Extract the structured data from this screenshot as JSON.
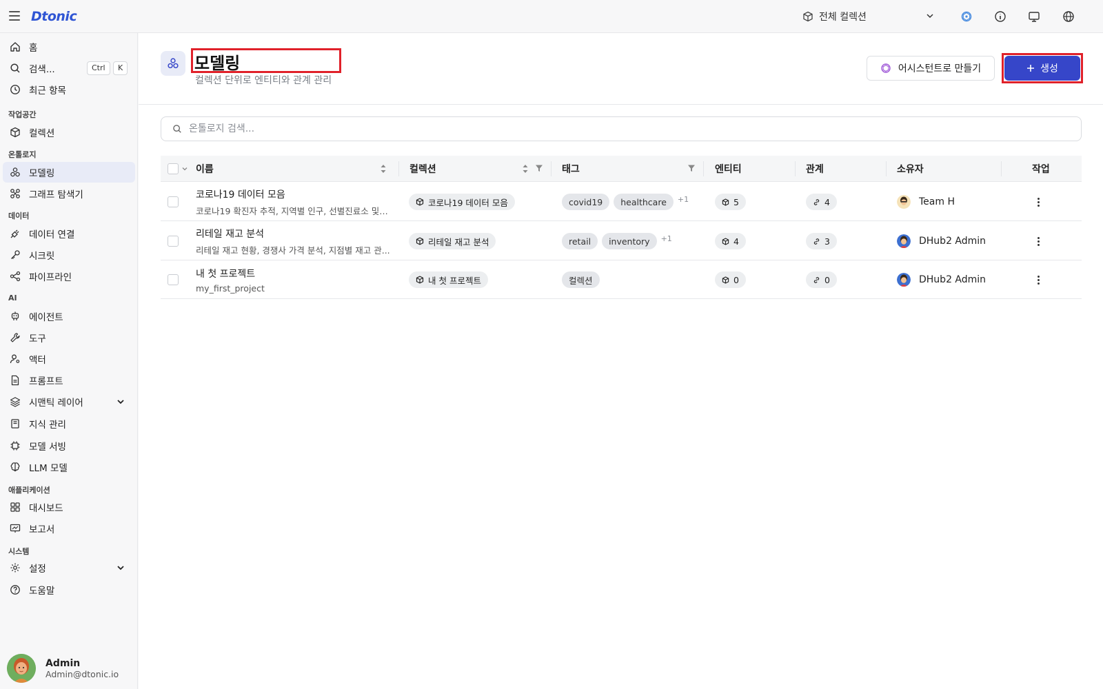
{
  "app": {
    "logo": "Dtonic"
  },
  "topbar": {
    "collection_selector": "전체 컬렉션"
  },
  "sidebar": {
    "home": "홈",
    "search": "검색...",
    "search_kbd_ctrl": "Ctrl",
    "search_kbd_k": "K",
    "recent": "최근 항목",
    "sections": {
      "workspace": "작업공간",
      "ontology": "온톨로지",
      "data": "데이터",
      "ai": "AI",
      "applications": "애플리케이션",
      "system": "시스템"
    },
    "items": {
      "collections": "컬렉션",
      "modeling": "모델링",
      "graph_explorer": "그래프 탐색기",
      "data_connection": "데이터 연결",
      "secrets": "시크릿",
      "pipelines": "파이프라인",
      "agents": "에이전트",
      "tools": "도구",
      "actors": "액터",
      "prompts": "프롬프트",
      "semantic_layer": "시맨틱 레이어",
      "knowledge": "지식 관리",
      "model_serving": "모델 서빙",
      "llm_models": "LLM 모델",
      "dashboards": "대시보드",
      "reports": "보고서",
      "settings": "설정",
      "help": "도움말"
    },
    "profile": {
      "name": "Admin",
      "email": "Admin@dtonic.io"
    }
  },
  "page": {
    "title": "모델링",
    "subtitle": "컬렉션 단위로 엔티티와 관계 관리",
    "assistant_button": "어시스턴트로 만들기",
    "create_button": "생성",
    "search_placeholder": "온톨로지 검색..."
  },
  "table": {
    "columns": {
      "name": "이름",
      "collection": "컬렉션",
      "tags": "태그",
      "entities": "엔티티",
      "relations": "관계",
      "owner": "소유자",
      "actions": "작업"
    },
    "rows": [
      {
        "name": "코로나19 데이터 모음",
        "desc": "코로나19 확진자 추적, 지역별 인구, 선별진료소 및 ...",
        "collection": "코로나19 데이터 모음",
        "tags": [
          "covid19",
          "healthcare"
        ],
        "tags_more": "+1",
        "entities": "5",
        "relations": "4",
        "owner": "Team H"
      },
      {
        "name": "리테일 재고 분석",
        "desc": "리테일 재고 현황, 경쟁사 가격 분석, 지점별 재고 관...",
        "collection": "리테일 재고 분석",
        "tags": [
          "retail",
          "inventory"
        ],
        "tags_more": "+1",
        "entities": "4",
        "relations": "3",
        "owner": "DHub2 Admin"
      },
      {
        "name": "내 첫 프로젝트",
        "desc": "my_first_project",
        "collection": "내 첫 프로젝트",
        "tags": [
          "컬렉션"
        ],
        "tags_more": "",
        "entities": "0",
        "relations": "0",
        "owner": "DHub2 Admin"
      }
    ]
  },
  "colors": {
    "accent": "#3646c9",
    "highlight": "#e0212a",
    "logo": "#2f55d4"
  }
}
